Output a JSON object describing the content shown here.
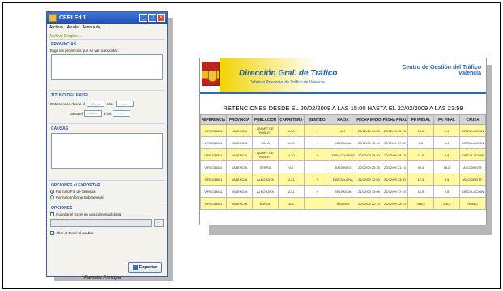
{
  "window": {
    "title": "CERI Ed 1",
    "menu": [
      "Archivo",
      "Ayuda",
      "Acerca de ..."
    ],
    "file_link": "Archivo Elegido ..."
  },
  "provincias": {
    "heading": "PROVINCIAS",
    "instruction": "Elige las provincias que se van a exportar:"
  },
  "titulo": {
    "heading": "TITULO DEL EXCEL",
    "retenciones_label": "Retenciones desde el",
    "hasta_label": "hasta el",
    "a_las": "a las",
    "date_placeholder": "--/--/----",
    "time_placeholder": "--:--"
  },
  "causas": {
    "heading": "CAUSAS"
  },
  "opciones_exportar": {
    "heading": "OPCIONES al EXPORTAR",
    "options": [
      "Formato Fin de Semana",
      "Formato Informe SubGeneral"
    ]
  },
  "opciones": {
    "heading": "OPCIONES",
    "guardar": "Guardar el Excel en una carpeta distinta",
    "abrir": "Abrir el Excel al acabar.",
    "browse": "..."
  },
  "export_button": "Exportar",
  "caption": "* Pantalla Principal",
  "report": {
    "org": "Dirección Gral. de Tráfico",
    "org_sub": "Jefatura Provincial de Tráfico de Valencia",
    "centro_line1": "Centro de Gestión del Tráfico",
    "centro_line2": "Valencia",
    "title": "RETENCIONES DESDE EL 20/02/2009 A LAS 15:00 HASTA EL 22/02/2009 A LAS 23:59",
    "columns": [
      "REFERENCIA",
      "PROVINCIA",
      "POBLACION",
      "CARRETERA",
      "SENTIDO",
      "HACIA",
      "FECHA INICIO",
      "FECHA FINAL",
      "PK INICIAL",
      "PK FINAL",
      "CAUSA"
    ],
    "rows": [
      [
        "V/R0228081",
        "VALENCIA",
        "QUART DE POBLET",
        "V-30",
        "+",
        "A-7",
        "20/02/09 14:55",
        "20/02/09 19:15",
        "16,5",
        "9,9",
        "CIRCULACION"
      ],
      [
        "V/R0228081",
        "VALENCIA",
        "SILLA",
        "V-31",
        "+",
        "VALENCIA",
        "20/02/09 15:10",
        "20/02/09 17:25",
        "6,5",
        "4,4",
        "CIRCULACION"
      ],
      [
        "V/R0228081",
        "VALENCIA",
        "QUART DE POBLET",
        "V-30",
        "+",
        "ATRACCIONES",
        "20/02/09 16:20",
        "20/02/09 18:15",
        "11,5",
        "9,9",
        "CIRCULACION"
      ],
      [
        "V/R0228081",
        "VALENCIA",
        "SERRA",
        "V-7",
        "",
        "SAGUNTO",
        "20/02/09 20:25",
        "20/02/09 21:10",
        "99,4",
        "98,2",
        "ACCIDENTE"
      ],
      [
        "V/R0228081",
        "VALENCIA",
        "ALBORAYA",
        "V-21",
        "+",
        "BARCELONA",
        "21/02/09 12:50",
        "21/02/09 13:30",
        "17,5",
        "9,9",
        "ACCIDENTE"
      ],
      [
        "V/R0228081",
        "VALENCIA",
        "ALBORAYA",
        "V-21",
        "+",
        "VALENCIA",
        "21/02/09 13:05",
        "21/02/09 17:40",
        "10,5",
        "9,5",
        "CIRCULACION"
      ],
      [
        "V/R0228081",
        "VALENCIA",
        "BUÑOL",
        "A-3",
        "",
        "MADRID",
        "22/02/09 22:10",
        "22/02/09 23:10",
        "318,9",
        "316,2",
        "HUMO"
      ]
    ]
  }
}
